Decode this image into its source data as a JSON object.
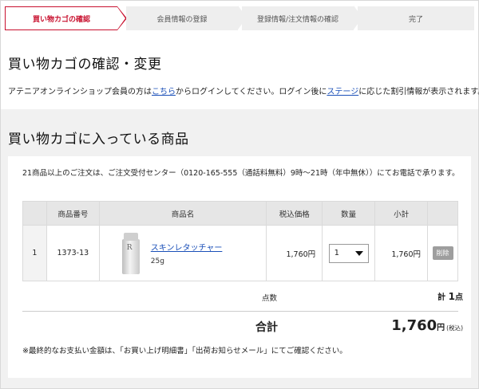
{
  "steps": [
    {
      "label": "買い物カゴの確認"
    },
    {
      "label": "会員情報の登録"
    },
    {
      "label": "登録情報/注文情報の確認"
    },
    {
      "label": "完了"
    }
  ],
  "page_title": "買い物カゴの確認・変更",
  "login_note": {
    "prefix": "アテニアオンラインショップ会員の方は",
    "link1": "こちら",
    "middle": "からログインしてください。ログイン後に",
    "link2": "ステージ",
    "suffix": "に応じた割引情報が表示されます。"
  },
  "cart_title": "買い物カゴに入っている商品",
  "phone_note": "21商品以上のご注文は、ご注文受付センター（0120-165-555（通話料無料）9時〜21時（年中無休））にてお電話で承ります。",
  "table": {
    "headers": [
      "",
      "商品番号",
      "商品名",
      "税込価格",
      "数量",
      "小計",
      ""
    ],
    "rows": [
      {
        "index": "1",
        "code": "1373-13",
        "name": "スキンレタッチャー",
        "volume": "25g",
        "price": "1,760円",
        "qty": "1",
        "subtotal": "1,760円",
        "delete_label": "削除"
      }
    ]
  },
  "summary": {
    "count_label": "点数",
    "count_prefix": "計",
    "count_value": "1",
    "count_unit": "点",
    "total_label": "合計",
    "total_value": "1,760",
    "total_unit": "円",
    "total_tax_note": "(税込)"
  },
  "final_note": "※最終的なお支払い金額は、「お買い上げ明細書」「出荷お知らせメール」にてご確認ください。",
  "colors": {
    "accent": "#c8102e",
    "link": "#1a4fb8",
    "panel_bg": "#f1f1f1"
  }
}
